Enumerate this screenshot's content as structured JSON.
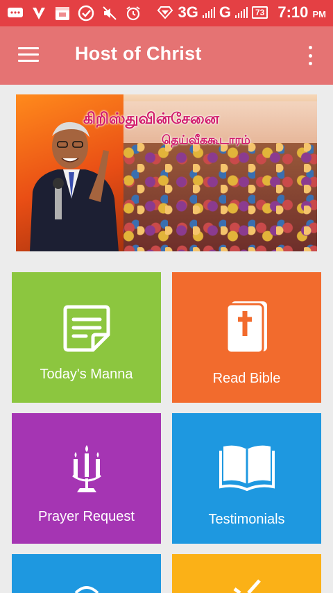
{
  "status_bar": {
    "network_type_1": "3G",
    "network_type_2": "G",
    "battery": "73",
    "time": "7:10",
    "ampm": "PM"
  },
  "app_bar": {
    "title": "Host of Christ"
  },
  "banner": {
    "title_line_1": "கிறிஸ்துவின்சேனை",
    "title_line_2": "தெய்வீககூடாரம்"
  },
  "tiles": [
    {
      "label": "Today's Manna",
      "color": "#8cc63f",
      "icon": "note-icon"
    },
    {
      "label": "Read Bible",
      "color": "#f26b2d",
      "icon": "bible-icon"
    },
    {
      "label": "Prayer Request",
      "color": "#a535b3",
      "icon": "candle-icon"
    },
    {
      "label": "Testimonials",
      "color": "#1e98e0",
      "icon": "open-book-icon"
    },
    {
      "label": "",
      "color": "#1e98e0",
      "icon": "partial-icon"
    },
    {
      "label": "",
      "color": "#fbb117",
      "icon": "check-icon"
    }
  ],
  "colors": {
    "status_bar": "#e44044",
    "app_bar": "#e57373",
    "background": "#ececec"
  }
}
